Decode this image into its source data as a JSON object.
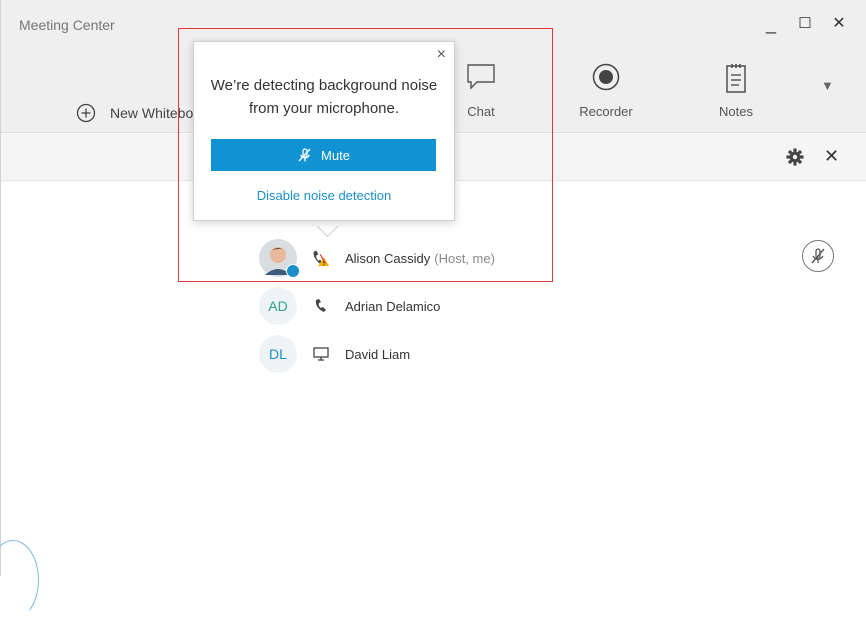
{
  "window": {
    "title": "Meeting Center",
    "minimize": "_",
    "maximize": "☐",
    "close": "✕"
  },
  "toolbar": {
    "new_whiteboard": "New Whiteboard",
    "chat": "Chat",
    "recorder": "Recorder",
    "notes": "Notes",
    "more": "▼"
  },
  "popup": {
    "message": "We’re detecting background noise from your microphone.",
    "close": "×",
    "mute_label": "Mute",
    "disable_link": "Disable noise detection"
  },
  "participants": [
    {
      "name": "Alison Cassidy",
      "role": "(Host, me)",
      "initials": "",
      "device": "phone-warning"
    },
    {
      "name": "Adrian Delamico",
      "role": "",
      "initials": "AD",
      "device": "phone"
    },
    {
      "name": "David Liam",
      "role": "",
      "initials": "DL",
      "device": "computer"
    }
  ],
  "panel": {
    "close": "✕"
  },
  "colors": {
    "accent": "#1193d3",
    "highlight_box": "#e53935",
    "warning": "#f5b400"
  }
}
